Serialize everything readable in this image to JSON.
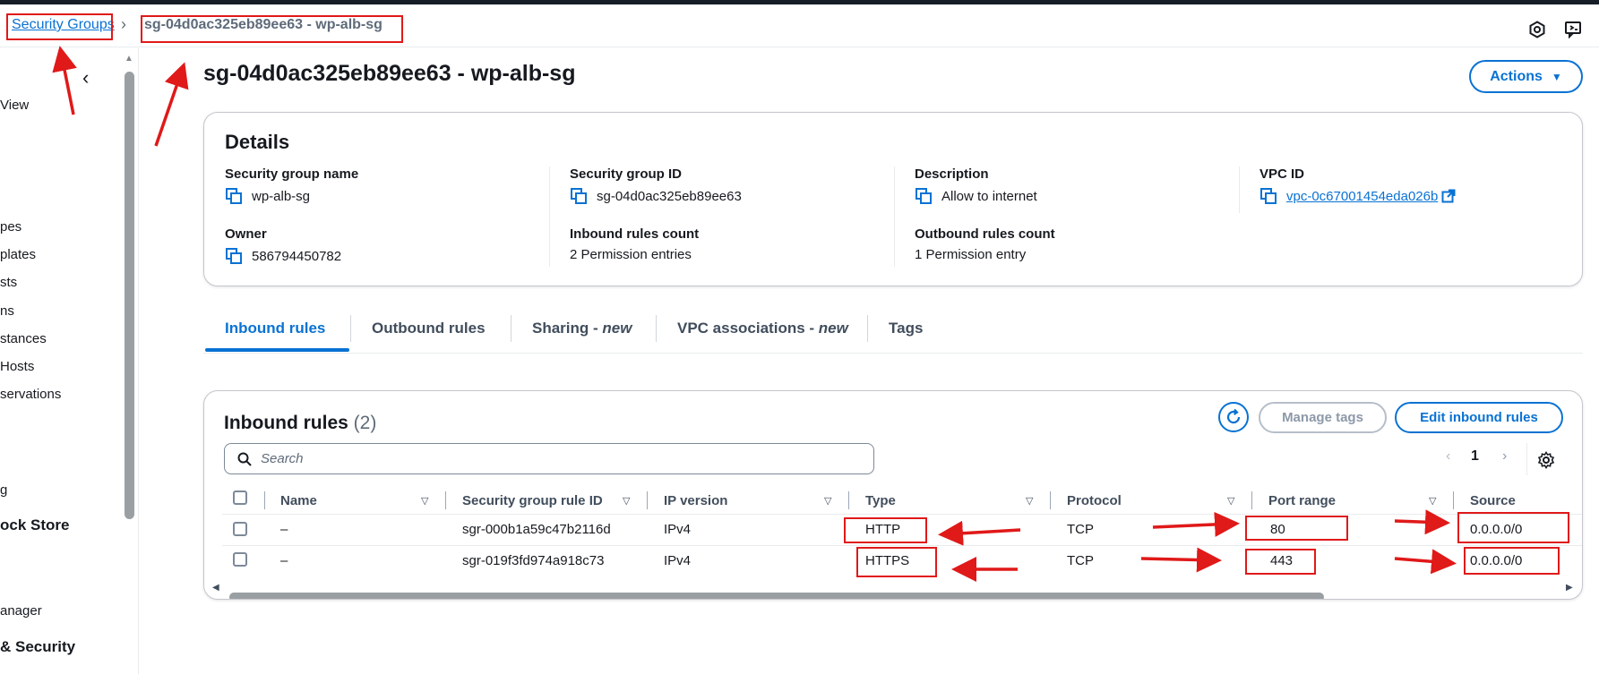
{
  "breadcrumb": {
    "parent": "Security Groups",
    "current": "sg-04d0ac325eb89ee63 - wp-alb-sg"
  },
  "top_icons": [
    "settings-hex-icon",
    "feedback-icon"
  ],
  "sidebar": {
    "items": [
      {
        "label": "View"
      },
      {
        "label": "pes"
      },
      {
        "label": "plates"
      },
      {
        "label": "sts"
      },
      {
        "label": "ns"
      },
      {
        "label": "stances"
      },
      {
        "label": "Hosts"
      },
      {
        "label": "servations"
      },
      {
        "label": "g"
      },
      {
        "label": "anager"
      }
    ],
    "headings": [
      {
        "label": "ock Store"
      },
      {
        "label": "& Security"
      }
    ]
  },
  "page": {
    "title": "sg-04d0ac325eb89ee63 - wp-alb-sg",
    "actions_label": "Actions"
  },
  "details": {
    "title": "Details",
    "fields": {
      "sg_name": {
        "label": "Security group name",
        "value": "wp-alb-sg"
      },
      "sg_id": {
        "label": "Security group ID",
        "value": "sg-04d0ac325eb89ee63"
      },
      "description": {
        "label": "Description",
        "value": "Allow to internet"
      },
      "vpc_id": {
        "label": "VPC ID",
        "value": "vpc-0c67001454eda026b"
      },
      "owner": {
        "label": "Owner",
        "value": "586794450782"
      },
      "inbound_count": {
        "label": "Inbound rules count",
        "value": "2 Permission entries"
      },
      "outbound_count": {
        "label": "Outbound rules count",
        "value": "1 Permission entry"
      }
    }
  },
  "tabs": {
    "inbound": "Inbound rules",
    "outbound": "Outbound rules",
    "sharing": "Sharing - ",
    "sharing_new": "new",
    "vpc_assoc": "VPC associations - ",
    "vpc_assoc_new": "new",
    "tags": "Tags"
  },
  "inbound_rules": {
    "title": "Inbound rules",
    "count": "(2)",
    "manage_tags_label": "Manage tags",
    "edit_label": "Edit inbound rules",
    "search_placeholder": "Search",
    "page": "1",
    "columns": [
      "Name",
      "Security group rule ID",
      "IP version",
      "Type",
      "Protocol",
      "Port range",
      "Source"
    ],
    "rows": [
      {
        "name": "–",
        "rule_id": "sgr-000b1a59c47b2116d",
        "ip_version": "IPv4",
        "type": "HTTP",
        "protocol": "TCP",
        "port_range": "80",
        "source": "0.0.0.0/0"
      },
      {
        "name": "–",
        "rule_id": "sgr-019f3fd974a918c73",
        "ip_version": "IPv4",
        "type": "HTTPS",
        "protocol": "TCP",
        "port_range": "443",
        "source": "0.0.0.0/0"
      }
    ]
  },
  "colors": {
    "accent": "#0972d3",
    "annotation": "#e01919",
    "text": "#16191f"
  }
}
